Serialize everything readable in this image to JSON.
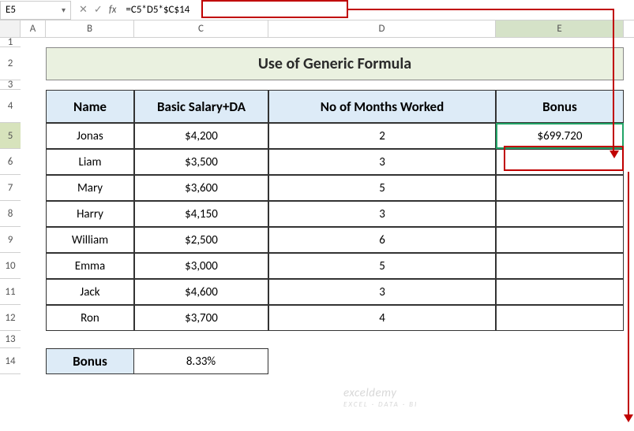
{
  "nameBox": "E5",
  "formula": "=C5*D5*$C$14",
  "columns": [
    "A",
    "B",
    "C",
    "D",
    "E"
  ],
  "rows": [
    "1",
    "2",
    "3",
    "4",
    "5",
    "6",
    "7",
    "8",
    "9",
    "10",
    "11",
    "12",
    "13",
    "14"
  ],
  "title": "Use of Generic Formula",
  "headers": {
    "name": "Name",
    "salary": "Basic Salary+DA",
    "months": "No of Months Worked",
    "bonus": "Bonus"
  },
  "table": [
    {
      "name": "Jonas",
      "salary": "$4,200",
      "months": "2",
      "bonus": "$699.720"
    },
    {
      "name": "Liam",
      "salary": "$3,500",
      "months": "3",
      "bonus": ""
    },
    {
      "name": "Mary",
      "salary": "$3,600",
      "months": "5",
      "bonus": ""
    },
    {
      "name": "Harry",
      "salary": "$4,150",
      "months": "3",
      "bonus": ""
    },
    {
      "name": "William",
      "salary": "$2,500",
      "months": "6",
      "bonus": ""
    },
    {
      "name": "Emma",
      "salary": "$3,000",
      "months": "5",
      "bonus": ""
    },
    {
      "name": "Jack",
      "salary": "$4,600",
      "months": "3",
      "bonus": ""
    },
    {
      "name": "Ron",
      "salary": "$3,700",
      "months": "4",
      "bonus": ""
    }
  ],
  "bonusRow": {
    "label": "Bonus",
    "value": "8.33%"
  },
  "watermark": {
    "main": "exceldemy",
    "sub": "EXCEL · DATA · BI"
  },
  "icons": {
    "dropdown": "▾",
    "cancel": "✕",
    "confirm": "✓",
    "fx": "fx"
  }
}
